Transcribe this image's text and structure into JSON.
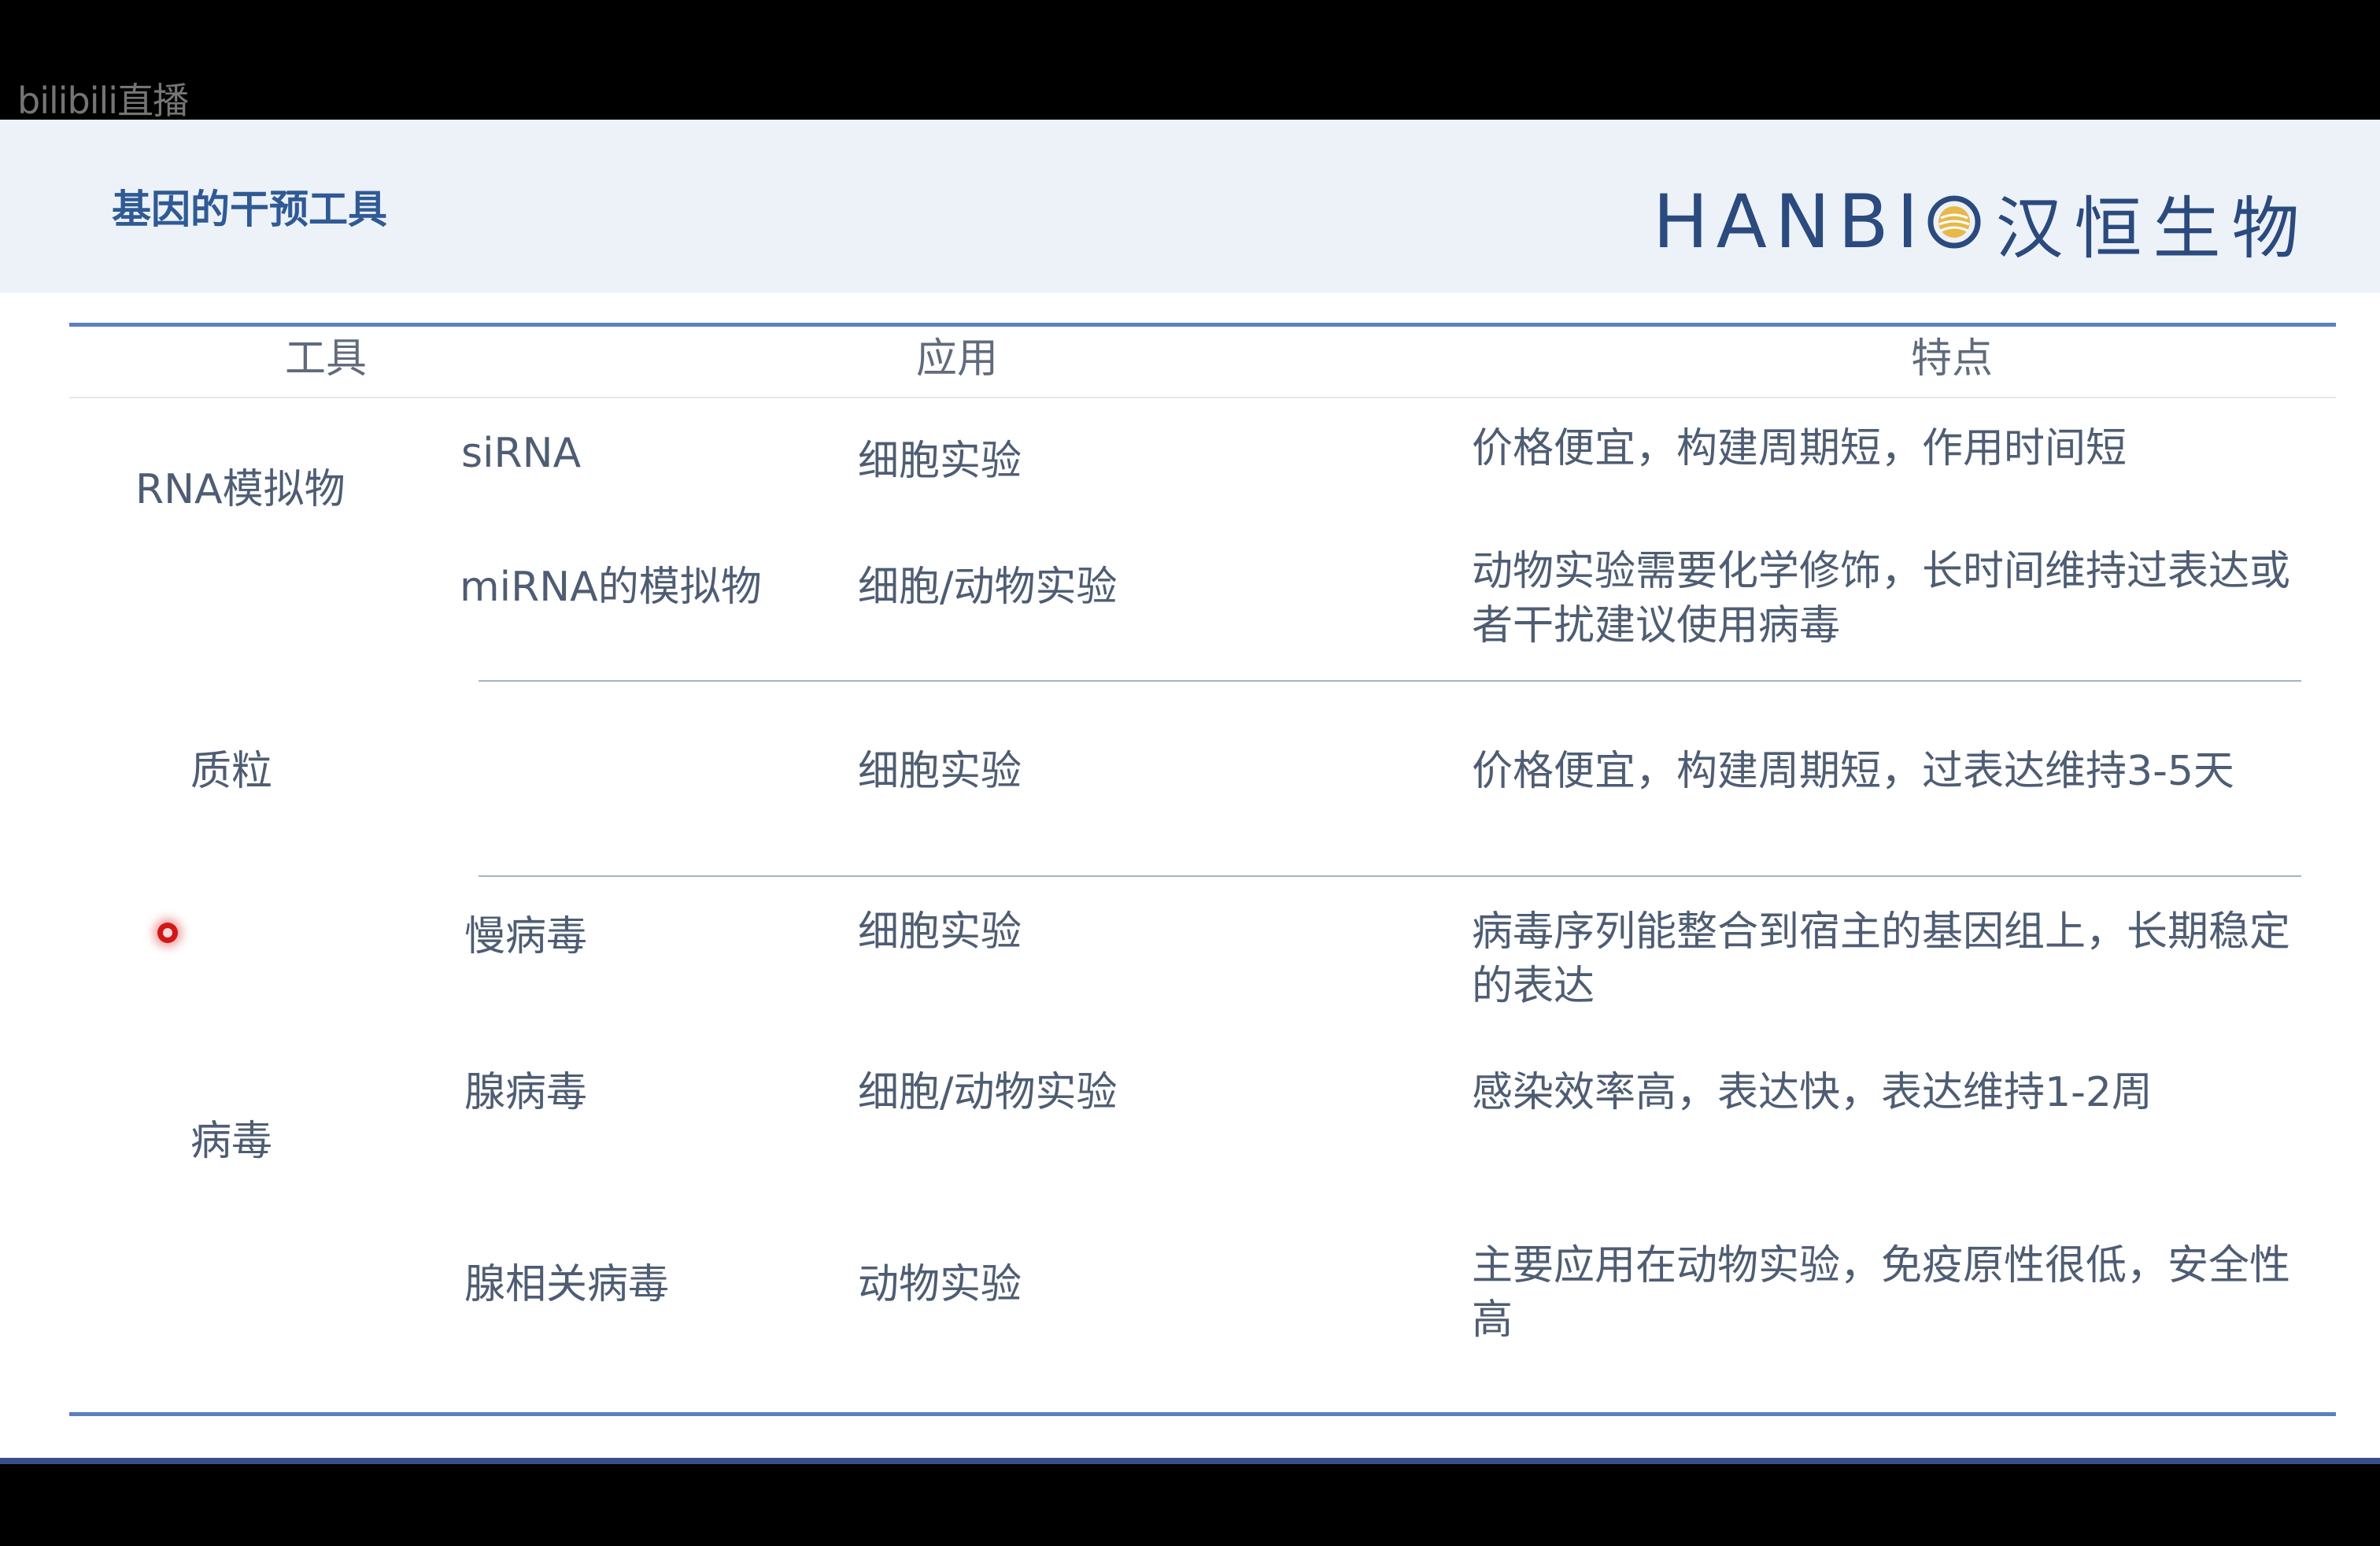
{
  "watermark": "bilibili直播",
  "slide": {
    "title": "基因的干预工具",
    "logo": {
      "text": "HANBI",
      "cn": "汉恒生物",
      "brand_color": "#2b4a7e"
    }
  },
  "table": {
    "headers": {
      "tool": "工具",
      "application": "应用",
      "feature": "特点"
    },
    "groups": [
      {
        "name": "RNA模拟物",
        "rows": [
          {
            "sub": "siRNA",
            "app": "细胞实验",
            "feature": "价格便宜，构建周期短，作用时间短"
          },
          {
            "sub": "miRNA的模拟物",
            "app": "细胞/动物实验",
            "feature": "动物实验需要化学修饰，长时间维持过表达或者干扰建议使用病毒"
          }
        ]
      },
      {
        "name": "质粒",
        "rows": [
          {
            "sub": "",
            "app": "细胞实验",
            "feature": "价格便宜，构建周期短，过表达维持3-5天"
          }
        ]
      },
      {
        "name": "病毒",
        "rows": [
          {
            "sub": "慢病毒",
            "app": "细胞实验",
            "feature": "病毒序列能整合到宿主的基因组上，长期稳定的表达"
          },
          {
            "sub": "腺病毒",
            "app": "细胞/动物实验",
            "feature": "感染效率高，表达快，表达维持1-2周"
          },
          {
            "sub": "腺相关病毒",
            "app": "动物实验",
            "feature": "主要应用在动物实验，免疫原性很低，安全性高"
          }
        ]
      }
    ]
  },
  "colors": {
    "accent": "#5b7fc0",
    "header_bg": "#edf2f9",
    "title": "#2f5a94",
    "pointer": "#d01818"
  }
}
